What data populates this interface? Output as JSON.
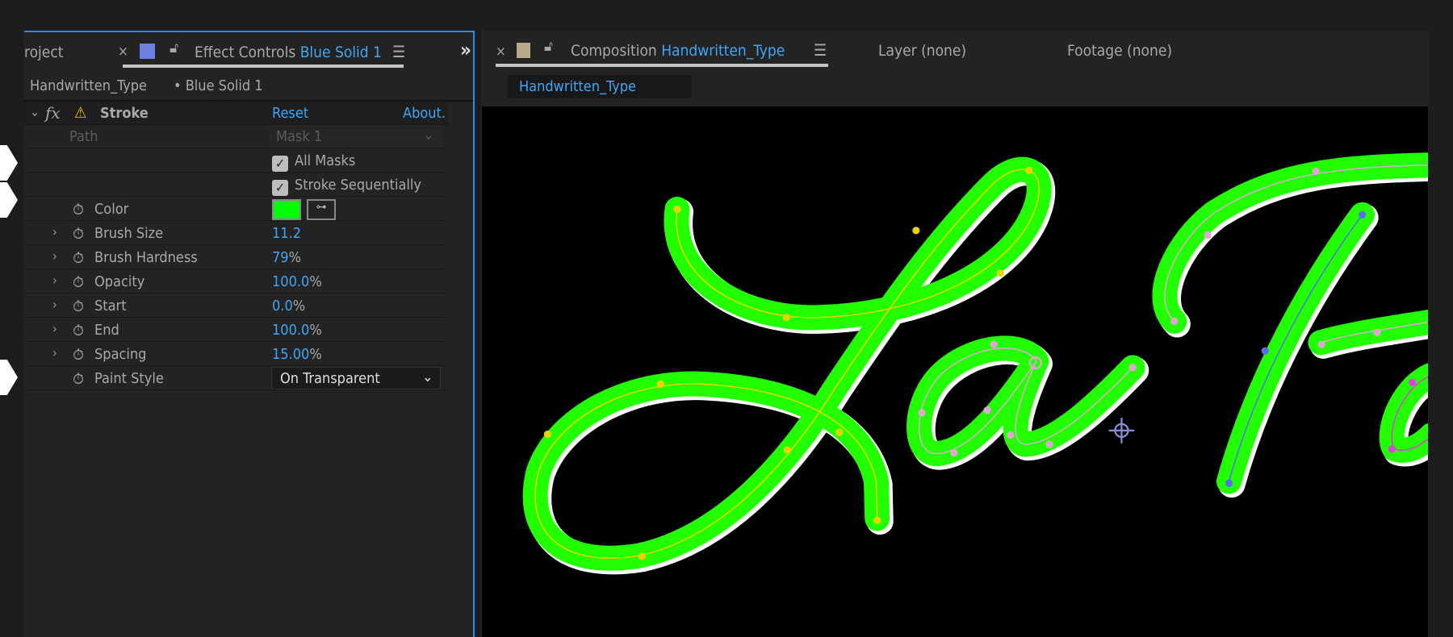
{
  "left_panel": {
    "project_tab": "roject",
    "effect_tab_prefix": "Effect Controls",
    "effect_tab_layer": "Blue Solid 1",
    "more_icon": "»",
    "breadcrumb_comp": "Handwritten_Type",
    "breadcrumb_layer": "• Blue Solid 1",
    "effect": {
      "name": "Stroke",
      "fx": "fx",
      "reset": "Reset",
      "about": "About."
    },
    "path": {
      "label": "Path",
      "value": "Mask 1"
    },
    "all_masks": "All Masks",
    "stroke_sequentially": "Stroke Sequentially",
    "color": {
      "label": "Color",
      "swatch": "#00ff00"
    },
    "props": [
      {
        "label": "Brush Size",
        "value": "11.2",
        "unit": ""
      },
      {
        "label": "Brush Hardness",
        "value": "79",
        "unit": "%"
      },
      {
        "label": "Opacity",
        "value": "100.0",
        "unit": "%"
      },
      {
        "label": "Start",
        "value": "0.0",
        "unit": "%"
      },
      {
        "label": "End",
        "value": "100.0",
        "unit": "%"
      },
      {
        "label": "Spacing",
        "value": "15.00",
        "unit": "%"
      }
    ],
    "paint_style": {
      "label": "Paint Style",
      "value": "On Transparent"
    }
  },
  "right_panel": {
    "comp_tab_prefix": "Composition",
    "comp_tab_name": "Handwritten_Type",
    "layer_tab": "Layer (none)",
    "footage_tab": "Footage (none)",
    "comp_chip": "Handwritten_Type"
  },
  "colors": {
    "accent": "#3ea6f5",
    "stroke_green": "#22ff00",
    "path_yellow": "#e8d400",
    "layer_swatch": "#6f7fe0",
    "comp_swatch": "#b8a88a"
  }
}
